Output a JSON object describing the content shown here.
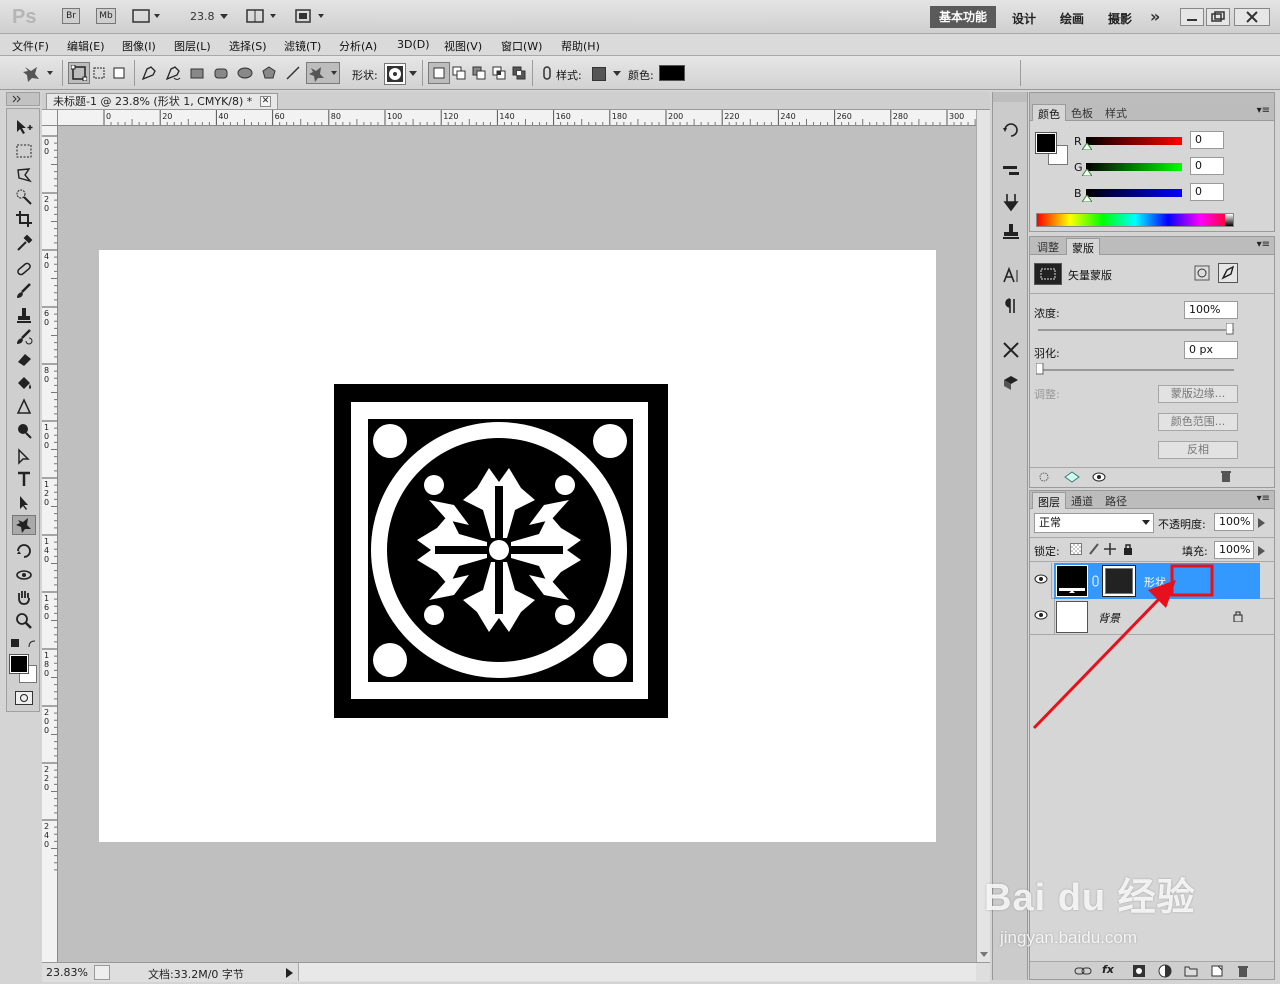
{
  "app": {
    "logo": "Ps",
    "bridge": "Br",
    "minibridge": "Mb",
    "zoom": "23.8",
    "workspaces": [
      "基本功能",
      "设计",
      "绘画",
      "摄影"
    ],
    "more": "»"
  },
  "menu": [
    "文件(F)",
    "编辑(E)",
    "图像(I)",
    "图层(L)",
    "选择(S)",
    "滤镜(T)",
    "分析(A)",
    "3D(D)",
    "视图(V)",
    "窗口(W)",
    "帮助(H)"
  ],
  "options": {
    "shape_label": "形状:",
    "style_label": "样式:",
    "color_label": "颜色:",
    "color": "#000000"
  },
  "document": {
    "tab_title": "未标题-1 @ 23.8% (形状 1, CMYK/8) *",
    "ruler_h": [
      "0",
      "20",
      "40",
      "60",
      "80",
      "100",
      "120",
      "140",
      "160",
      "180",
      "200",
      "220",
      "240",
      "260",
      "280",
      "300"
    ],
    "ruler_v": [
      "0",
      "2",
      "4",
      "6",
      "8",
      "10",
      "12",
      "14",
      "16",
      "18",
      "20",
      "22",
      "24"
    ],
    "zoom_status": "23.83%",
    "doc_status": "文档:33.2M/0 字节"
  },
  "color_panel": {
    "tabs": [
      "颜色",
      "色板",
      "样式"
    ],
    "r_label": "R",
    "g_label": "G",
    "b_label": "B",
    "r": "0",
    "g": "0",
    "b": "0"
  },
  "masks_panel": {
    "tabs": [
      "调整",
      "蒙版"
    ],
    "title": "矢量蒙版",
    "density_label": "浓度:",
    "density": "100%",
    "feather_label": "羽化:",
    "feather": "0 px",
    "refine_label": "调整:",
    "buttons": [
      "蒙版边缘...",
      "颜色范围...",
      "反相"
    ]
  },
  "layers_panel": {
    "tabs": [
      "图层",
      "通道",
      "路径"
    ],
    "blend_mode": "正常",
    "opacity_label": "不透明度:",
    "opacity": "100%",
    "lock_label": "锁定:",
    "fill_label": "填充:",
    "fill": "100%",
    "layers": [
      {
        "name": "形状",
        "selected": true
      },
      {
        "name": "背景",
        "selected": false
      }
    ]
  },
  "annotation": {
    "color": "#e8101a"
  },
  "watermark": {
    "brand": "Bai du 经验",
    "url": "jingyan.baidu.com"
  }
}
